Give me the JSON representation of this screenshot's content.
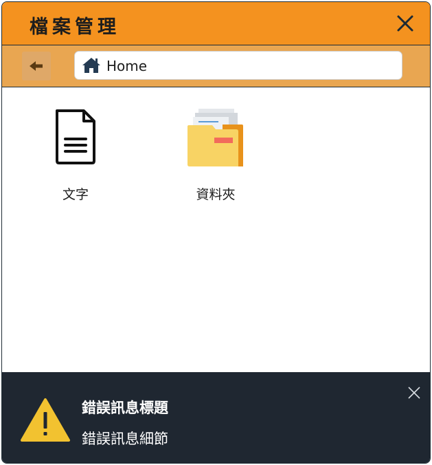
{
  "window": {
    "title": "檔案管理"
  },
  "toolbar": {
    "path": "Home"
  },
  "files": [
    {
      "name": "文字",
      "icon": "document-icon"
    },
    {
      "name": "資料夾",
      "icon": "folder-icon"
    }
  ],
  "toast": {
    "title": "錯誤訊息標題",
    "detail": "錯誤訊息細節",
    "icon": "warning-icon"
  },
  "colors": {
    "titlebar": "#f4921f",
    "toolbar": "#e9a651",
    "toast_bg": "#1f2731",
    "warning": "#f2c230"
  }
}
